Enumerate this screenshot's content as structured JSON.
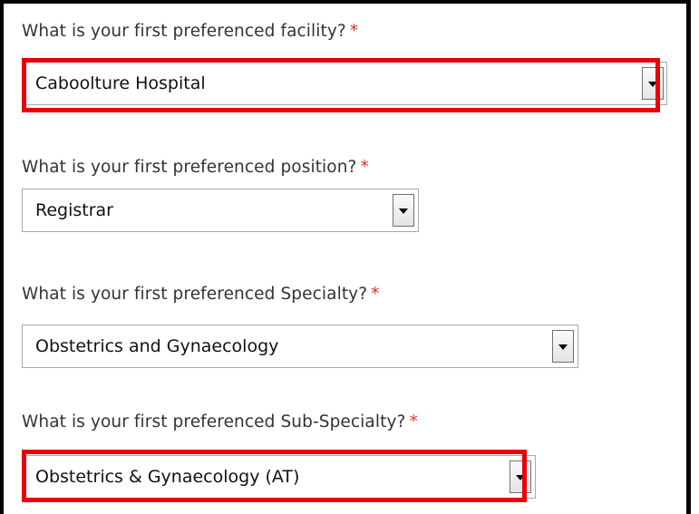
{
  "form": {
    "required_marker": "*",
    "accent_color": "#e8000b",
    "fields": [
      {
        "label": "What is your first preferenced facility?",
        "selected": "Caboolture Hospital",
        "highlighted": true
      },
      {
        "label": "What is your first preferenced position?",
        "selected": "Registrar",
        "highlighted": false
      },
      {
        "label": "What is your first preferenced Specialty?",
        "selected": "Obstetrics and Gynaecology",
        "highlighted": false
      },
      {
        "label": "What is your first preferenced Sub-Specialty?",
        "selected": "Obstetrics & Gynaecology (AT)",
        "highlighted": true
      }
    ]
  }
}
